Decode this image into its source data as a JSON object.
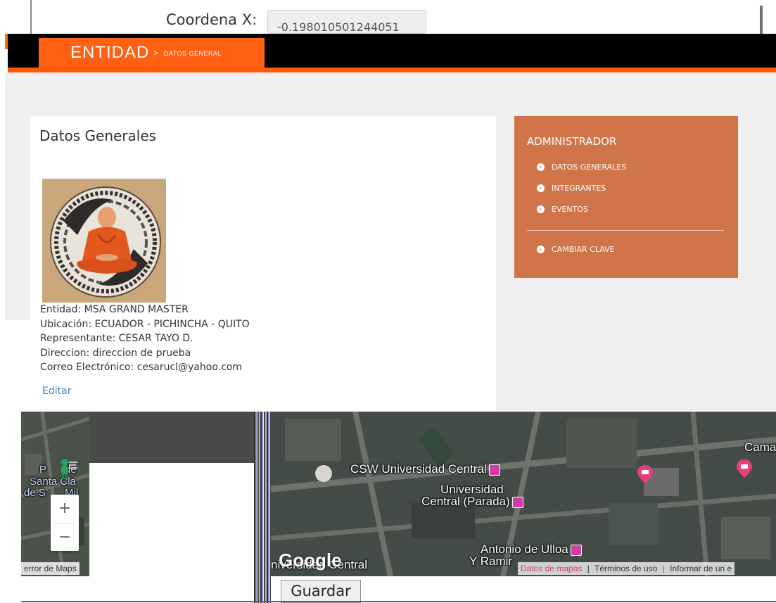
{
  "form": {
    "coord_x_label": "Coordena X:",
    "coord_x_value": "-0.198010501244051"
  },
  "header": {
    "title": "ENTIDAD",
    "separator": ">",
    "subtitle": "DATOS GENERAL"
  },
  "panel": {
    "title": "Datos Generales",
    "info": [
      "Entidad: MSA GRAND MASTER",
      "Ubicación: ECUADOR - PICHINCHA - QUITO",
      "Representante: CESAR TAYO D.",
      "Direccion: direccion de prueba",
      "Correo Electrónico: cesarucl@yahoo.com"
    ],
    "edit_label": "Editar"
  },
  "admin": {
    "title": "ADMINISTRADOR",
    "items": [
      "DATOS GENERALES",
      "INTEGRANTES",
      "EVENTOS"
    ],
    "change_password": "CAMBIAR CLAVE"
  },
  "map": {
    "zoom_in": "+",
    "zoom_out": "−",
    "left_labels": [
      "P",
      "de",
      "Santa Cla",
      "de S",
      "Mil"
    ],
    "left_attribution": "error de Maps",
    "labels": {
      "csw": "CSW Universidad Central",
      "univ_parada_1": "Universidad",
      "univ_parada_2": "Central (Parada)",
      "antonio_1": "Antonio de Ulloa",
      "antonio_2": "Y Ramir",
      "camari": "Camari",
      "univ_central": "niversidad Central"
    },
    "google_logo": "Google",
    "attribution": {
      "datos": "Datos de mapas",
      "terminos": "Términos de uso",
      "informar": "Informar de un e"
    }
  },
  "save_button": "Guardar",
  "colors": {
    "header_orange": "#ff6012",
    "admin_bg": "#d0744a",
    "link_blue": "#3a80c2"
  }
}
